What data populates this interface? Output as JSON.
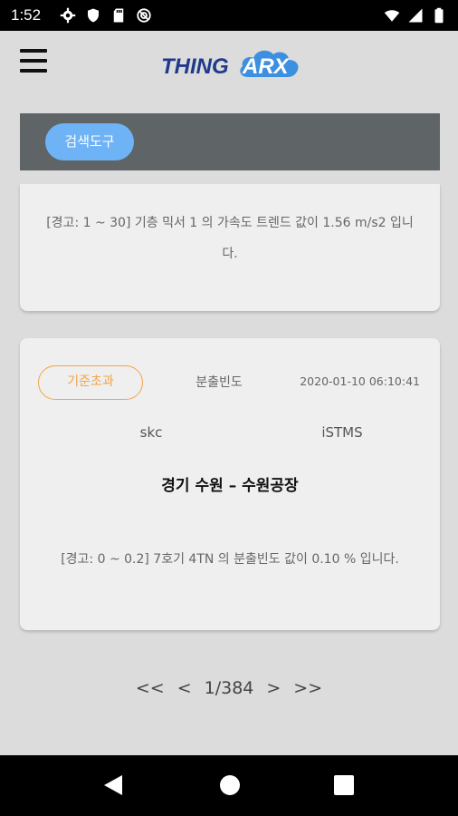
{
  "status_bar": {
    "time": "1:52",
    "left_icons": [
      "gear-icon",
      "shield-icon",
      "sd-card-icon",
      "sync-icon"
    ],
    "right_icons": [
      "wifi-icon",
      "signal-icon",
      "battery-icon"
    ]
  },
  "header": {
    "logo_part1": "THING",
    "logo_part2": "ARX",
    "logo_color": "#1f3a8a",
    "cloud_color": "#3d8fe0"
  },
  "search": {
    "button_label": "검색도구",
    "button_color": "#6fb3f7",
    "bar_color": "#5f6466"
  },
  "alerts": [
    {
      "message": "[경고: 1 ~ 30] 기층 믹서 1 의 가속도 트렌드 값이 1.56 m/s2 입니다."
    },
    {
      "badge": "기준초과",
      "badge_color": "#f2a44a",
      "metric": "분출빈도",
      "timestamp": "2020-01-10 06:10:41",
      "company": "skc",
      "system": "iSTMS",
      "location": "경기 수원 – 수원공장",
      "message": "[경고: 0 ~ 0.2] 7호기 4TN 의 분출빈도 값이 0.10 % 입니다."
    }
  ],
  "pagination": {
    "first": "<<",
    "prev": "<",
    "page_indicator": "1/384",
    "next": ">",
    "last": ">>"
  }
}
